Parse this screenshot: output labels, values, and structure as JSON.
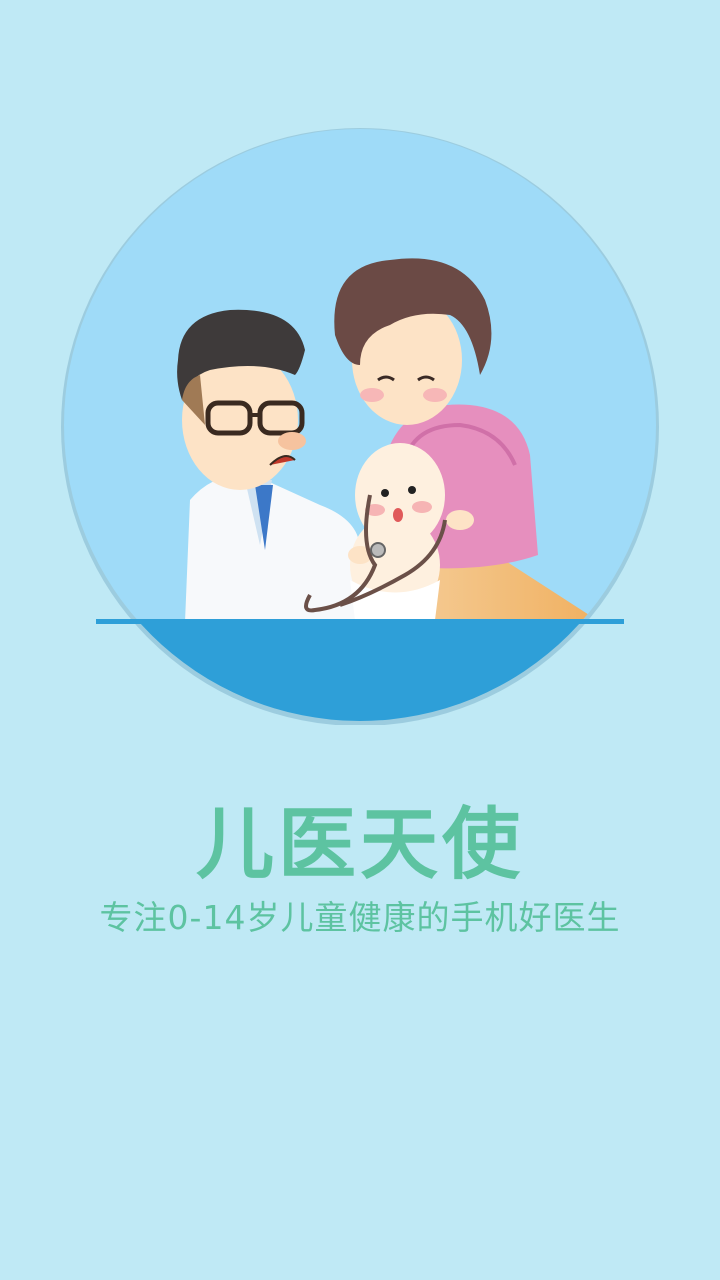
{
  "splash": {
    "app_name": "儿医天使",
    "slogan": "专注0-14岁儿童健康的手机好医生"
  },
  "colors": {
    "background": "#bfe9f5",
    "brand_text": "#5dc3a1",
    "circle_sky": "#9fdbf8",
    "circle_bottom": "#2e9fd8"
  },
  "illustration": {
    "subject": "doctor-examining-baby-with-grandmother-icon"
  }
}
